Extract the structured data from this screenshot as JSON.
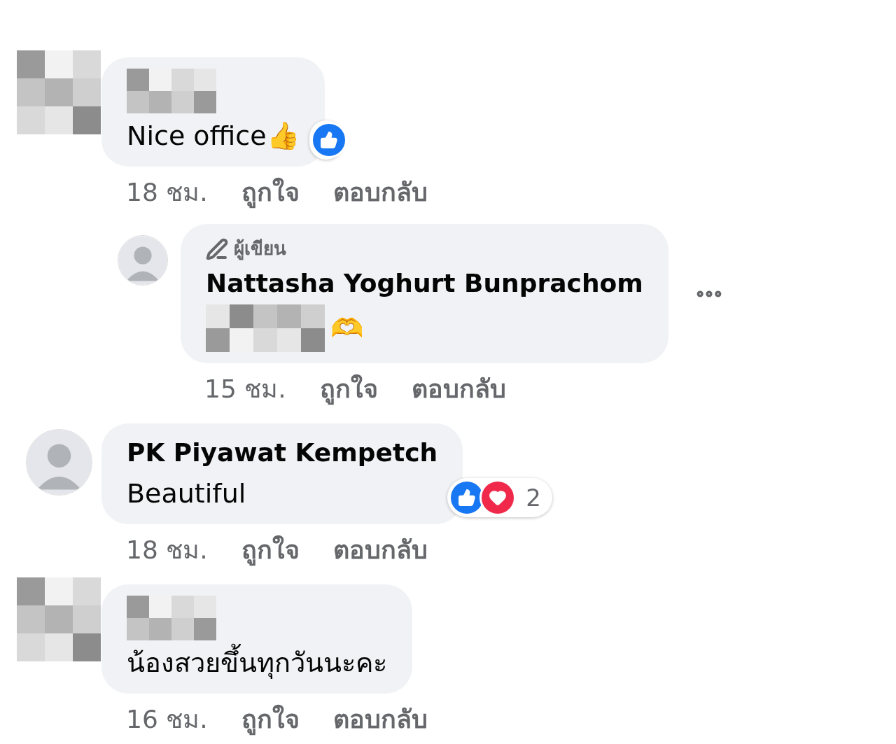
{
  "comments": [
    {
      "avatar": {
        "kind": "mosaic"
      },
      "author_hidden": true,
      "text": "Nice office👍",
      "reactions": [
        {
          "kind": "like"
        }
      ],
      "meta": [
        "18 ชม.",
        "ถูกใจ",
        "ตอบกลับ"
      ],
      "replies": [
        {
          "avatar": {
            "kind": "photo"
          },
          "badge": "ผู้เขียน",
          "author": "Nattasha Yoghurt Bunprachom",
          "text_hidden": true,
          "text": "🫶",
          "more_menu": true,
          "meta": [
            "15 ชม.",
            "ถูกใจ",
            "ตอบกลับ"
          ]
        }
      ]
    },
    {
      "avatar": {
        "kind": "photo"
      },
      "author": "PK Piyawat Kempetch",
      "text": "Beautiful",
      "reactions": [
        {
          "kind": "like"
        },
        {
          "kind": "love"
        }
      ],
      "reaction_count": "2",
      "meta": [
        "18 ชม.",
        "ถูกใจ",
        "ตอบกลับ"
      ]
    },
    {
      "avatar": {
        "kind": "mosaic"
      },
      "author_hidden": true,
      "text": "น้องสวยขึ้นทุกวันนะคะ",
      "meta": [
        "16 ชม.",
        "ถูกใจ",
        "ตอบกลับ"
      ]
    }
  ]
}
